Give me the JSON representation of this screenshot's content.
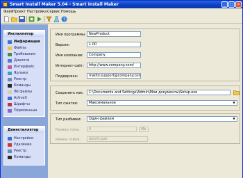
{
  "window": {
    "title": "Smart Install Maker 5.04 - Smart Install Maker",
    "minimize_glyph": "_",
    "maximize_glyph": "□",
    "close_glyph": "×"
  },
  "menu": [
    "Файл",
    "Проект",
    "Настройка",
    "Сервис",
    "Помощь"
  ],
  "toolbar": {
    "icons": [
      "new-file-icon",
      "open-folder-icon",
      "save-icon",
      "build-icon",
      "run-icon",
      "filter-icon",
      "test-icon",
      "help-icon"
    ]
  },
  "sidebar": {
    "installer": {
      "title": "Инсталлятор",
      "items": [
        {
          "label": "Информация",
          "active": true
        },
        {
          "label": "Файлы"
        },
        {
          "label": "Требования"
        },
        {
          "label": "Диалоги"
        },
        {
          "label": "Интерфейс"
        },
        {
          "label": "Ярлыки"
        },
        {
          "label": "Реестр"
        },
        {
          "label": "Команды"
        },
        {
          "label": "INI файлы"
        },
        {
          "label": "ActiveX"
        },
        {
          "label": "Шрифты"
        },
        {
          "label": "Переменные"
        }
      ]
    },
    "uninstaller": {
      "title": "Деинсталлятор",
      "items": [
        {
          "label": "Настройки"
        },
        {
          "label": "Удаление"
        },
        {
          "label": "Реестр"
        },
        {
          "label": "Команды"
        }
      ]
    }
  },
  "info": {
    "program_name_label": "Имя программы:",
    "program_name_value": "NewProduct",
    "version_label": "Версия:",
    "version_value": "1.00",
    "company_label": "Имя компании:",
    "company_value": "Company",
    "website_label": "Интернет-сайт:",
    "website_value": "http://www.company.com/",
    "support_label": "Поддержка:",
    "support_value": "mailto:support@company.com"
  },
  "output": {
    "save_as_label": "Сохранить как:",
    "save_as_value": "C:\\Documents and Settings\\Admin\\Мои документы\\Setup.exe",
    "compression_label": "Тип сжатия:",
    "compression_value": "Максимальное"
  },
  "split": {
    "split_type_label": "Тип разбивки:",
    "split_type_value": "Один файлом",
    "volume_size_label": "Размер тома:",
    "volume_size_value": "0",
    "volume_unit_value": "Mb",
    "volume_name_label": "Имена томов:",
    "volume_name_value": "data%.pak"
  },
  "colors": {
    "title_bar": "#0a3fc0",
    "sidebar_bg": "#8aa6d8",
    "panel_bg": "#d6dff5",
    "window_bg": "#ece9d8"
  }
}
